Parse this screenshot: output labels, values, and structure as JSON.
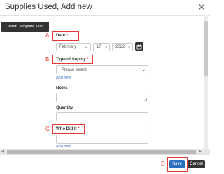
{
  "dialog": {
    "title": "Supplies Used, Add new"
  },
  "toolbar": {
    "insert_template_label": "Insert Template Text"
  },
  "form": {
    "date": {
      "label": "Date",
      "required_mark": "*",
      "month": "February",
      "day": "17",
      "year": "2022"
    },
    "type_of_supply": {
      "label": "Type of Supply",
      "required_mark": "*",
      "placeholder": "Please select",
      "add_new": "Add new"
    },
    "notes": {
      "label": "Notes",
      "value": ""
    },
    "quantity": {
      "label": "Quantity",
      "value": ""
    },
    "who_did_it": {
      "label": "Who Did It",
      "required_mark": "*",
      "value": "",
      "add_new": "Add new"
    }
  },
  "footer": {
    "save_label": "Save",
    "cancel_label": "Cancel"
  },
  "annotations": {
    "a": "A",
    "b": "B",
    "c": "C",
    "d": "D"
  },
  "colors": {
    "annotation_red": "#e53935",
    "save_blue": "#2a6fbd",
    "dark_button": "#333333",
    "link_blue": "#4a7bc8"
  },
  "icons": {
    "close": "close-icon",
    "calendar": "calendar-icon",
    "chevron": "chevron-down-icon",
    "resize": "resize-handle-icon"
  }
}
